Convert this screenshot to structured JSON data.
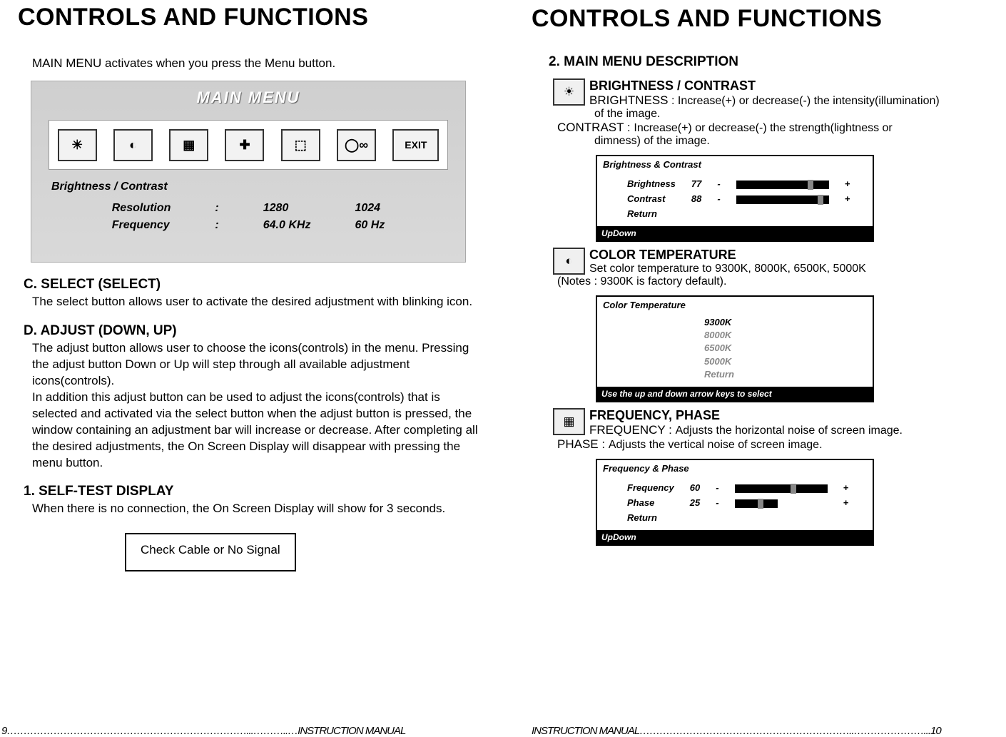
{
  "left": {
    "title": "CONTROLS AND FUNCTIONS",
    "intro": "MAIN MENU activates when you press the Menu button.",
    "main_menu": {
      "header": "MAIN  MENU",
      "exit_label": "EXIT",
      "selected_label": "Brightness / Contrast",
      "row1_label": "Resolution",
      "row1_sep": ":",
      "row1_val1": "1280",
      "row1_val2": "1024",
      "row2_label": "Frequency",
      "row2_sep": ":",
      "row2_val1": "64.0 KHz",
      "row2_val2": "60 Hz"
    },
    "c_h": "C. SELECT (SELECT)",
    "c_body": "The select button allows user to activate the desired adjustment with blinking icon.",
    "d_h": "D. ADJUST (DOWN, UP)",
    "d_body": "The adjust button allows user to choose the icons(controls) in the menu. Pressing the adjust button Down or Up will step through all available adjustment icons(controls).\nIn addition this adjust button can be used to adjust the icons(controls) that is selected and activated via the select button when the adjust button is pressed, the window containing an adjustment bar will increase or decrease. After completing all the desired adjustments, the On Screen Display will disappear with pressing the menu button.",
    "e_h": "1. SELF-TEST DISPLAY",
    "e_body": "When there is no connection, the On Screen Display will show for 3 seconds.",
    "nosignal": "Check Cable or No Signal",
    "footer": "9………………………………………………………………...………..…INSTRUCTION MANUAL"
  },
  "right": {
    "title": "CONTROLS AND FUNCTIONS",
    "subh": "2. MAIN MENU DESCRIPTION",
    "bc_h": "BRIGHTNESS / CONTRAST",
    "bc_b1a": "BRIGHTNESS",
    "bc_b1b": " : Increase(+) or decrease(-) the intensity(illumination)",
    "bc_b1c": "of the image.",
    "bc_c1a": "CONTRAST : ",
    "bc_c1b": "Increase(+) or decrease(-) the strength(lightness or",
    "bc_c1c": "dimness) of the image.",
    "osd_bc": {
      "title": "Brightness & Contrast",
      "row1_label": "Brightness",
      "row1_val": "77",
      "row2_label": "Contrast",
      "row2_val": "88",
      "row3_label": "Return",
      "footer": "UpDown"
    },
    "ct_h": "COLOR TEMPERATURE",
    "ct_b1": "Set color temperature to 9300K, 8000K, 6500K, 5000K",
    "ct_b2": "(Notes : 9300K is factory default).",
    "osd_ct": {
      "title": "Color Temperature",
      "o1": "9300K",
      "o2": "8000K",
      "o3": "6500K",
      "o4": "5000K",
      "o5": "Return",
      "footer": "Use the up and down arrow keys to select"
    },
    "fp_h": "FREQUENCY, PHASE",
    "fp_b1a": "FREQUENCY : ",
    "fp_b1b": "Adjusts the horizontal noise of screen image.",
    "fp_b2a": "PHASE : ",
    "fp_b2b": "Adjusts the vertical noise of screen image.",
    "osd_fp": {
      "title": "Frequency & Phase",
      "row1_label": "Frequency",
      "row1_val": "60",
      "row2_label": "Phase",
      "row2_val": "25",
      "row3_label": "Return",
      "footer": "UpDown"
    },
    "footer": "INSTRUCTION MANUAL………………………………………………………..…………………...10"
  }
}
